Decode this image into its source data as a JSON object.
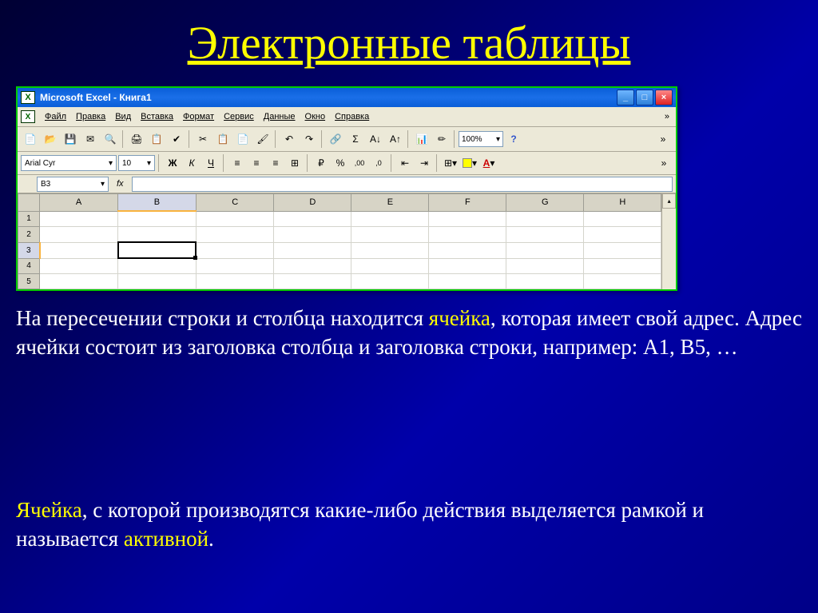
{
  "slide": {
    "title": "Электронные таблицы"
  },
  "window": {
    "title": "Microsoft Excel - Книга1",
    "icon_label": "X"
  },
  "menu": {
    "file": "Файл",
    "edit": "Правка",
    "view": "Вид",
    "insert": "Вставка",
    "format": "Формат",
    "tools": "Сервис",
    "data": "Данные",
    "window": "Окно",
    "help": "Справка"
  },
  "toolbar": {
    "zoom": "100%"
  },
  "format_bar": {
    "font": "Arial Cyr",
    "size": "10",
    "bold": "Ж",
    "italic": "К",
    "underline": "Ч",
    "currency": "₽",
    "percent": "%",
    "font_a": "A"
  },
  "formula_bar": {
    "namebox": "B3",
    "fx": "fx"
  },
  "grid": {
    "columns": [
      "A",
      "B",
      "C",
      "D",
      "E",
      "F",
      "G",
      "H"
    ],
    "rows": [
      "1",
      "2",
      "3",
      "4",
      "5"
    ],
    "active_cell": "B3"
  },
  "body": {
    "p1_a": "На пересечении строки и столбца находится ",
    "p1_cell": "ячейка",
    "p1_b": ", которая имеет свой адрес. Адрес ячейки состоит из заголовка столбца  и заголовка строки, например: А1, В5, …",
    "p2_a": "Ячейка",
    "p2_b": ",  с которой производятся какие-либо действия выделяется рамкой и называется ",
    "p2_active": "активной",
    "p2_c": "."
  }
}
